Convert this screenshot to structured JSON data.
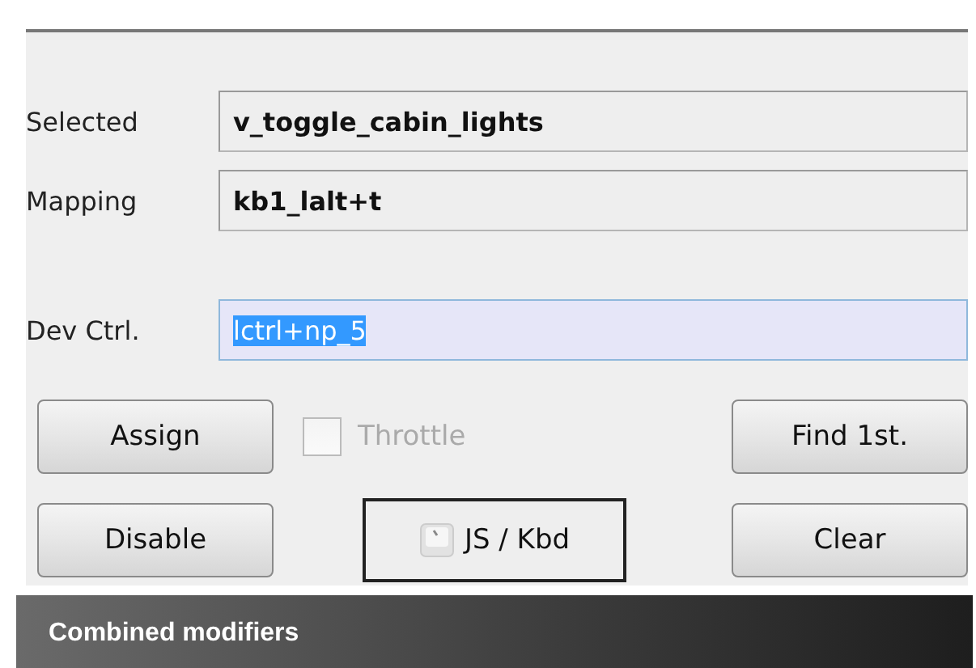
{
  "fields": [
    {
      "label": "Selected",
      "value": "v_toggle_cabin_lights",
      "kind": "readonly"
    },
    {
      "label": "Mapping",
      "value": "kb1_lalt+t",
      "kind": "readonly"
    },
    {
      "label": "Dev Ctrl.",
      "value": "lctrl+np_5",
      "kind": "input",
      "selected": true
    }
  ],
  "buttons_row_1": [
    {
      "kind": "button",
      "label": "Assign"
    },
    {
      "kind": "checkbox",
      "label": "Throttle",
      "checked": false,
      "disabled": true
    },
    {
      "kind": "button",
      "label": "Find 1st."
    }
  ],
  "buttons_row_2": [
    {
      "kind": "button",
      "label": "Disable"
    },
    {
      "kind": "toggle",
      "label": "JS / Kbd"
    },
    {
      "kind": "button",
      "label": "Clear"
    }
  ],
  "caption": "Combined modifiers"
}
